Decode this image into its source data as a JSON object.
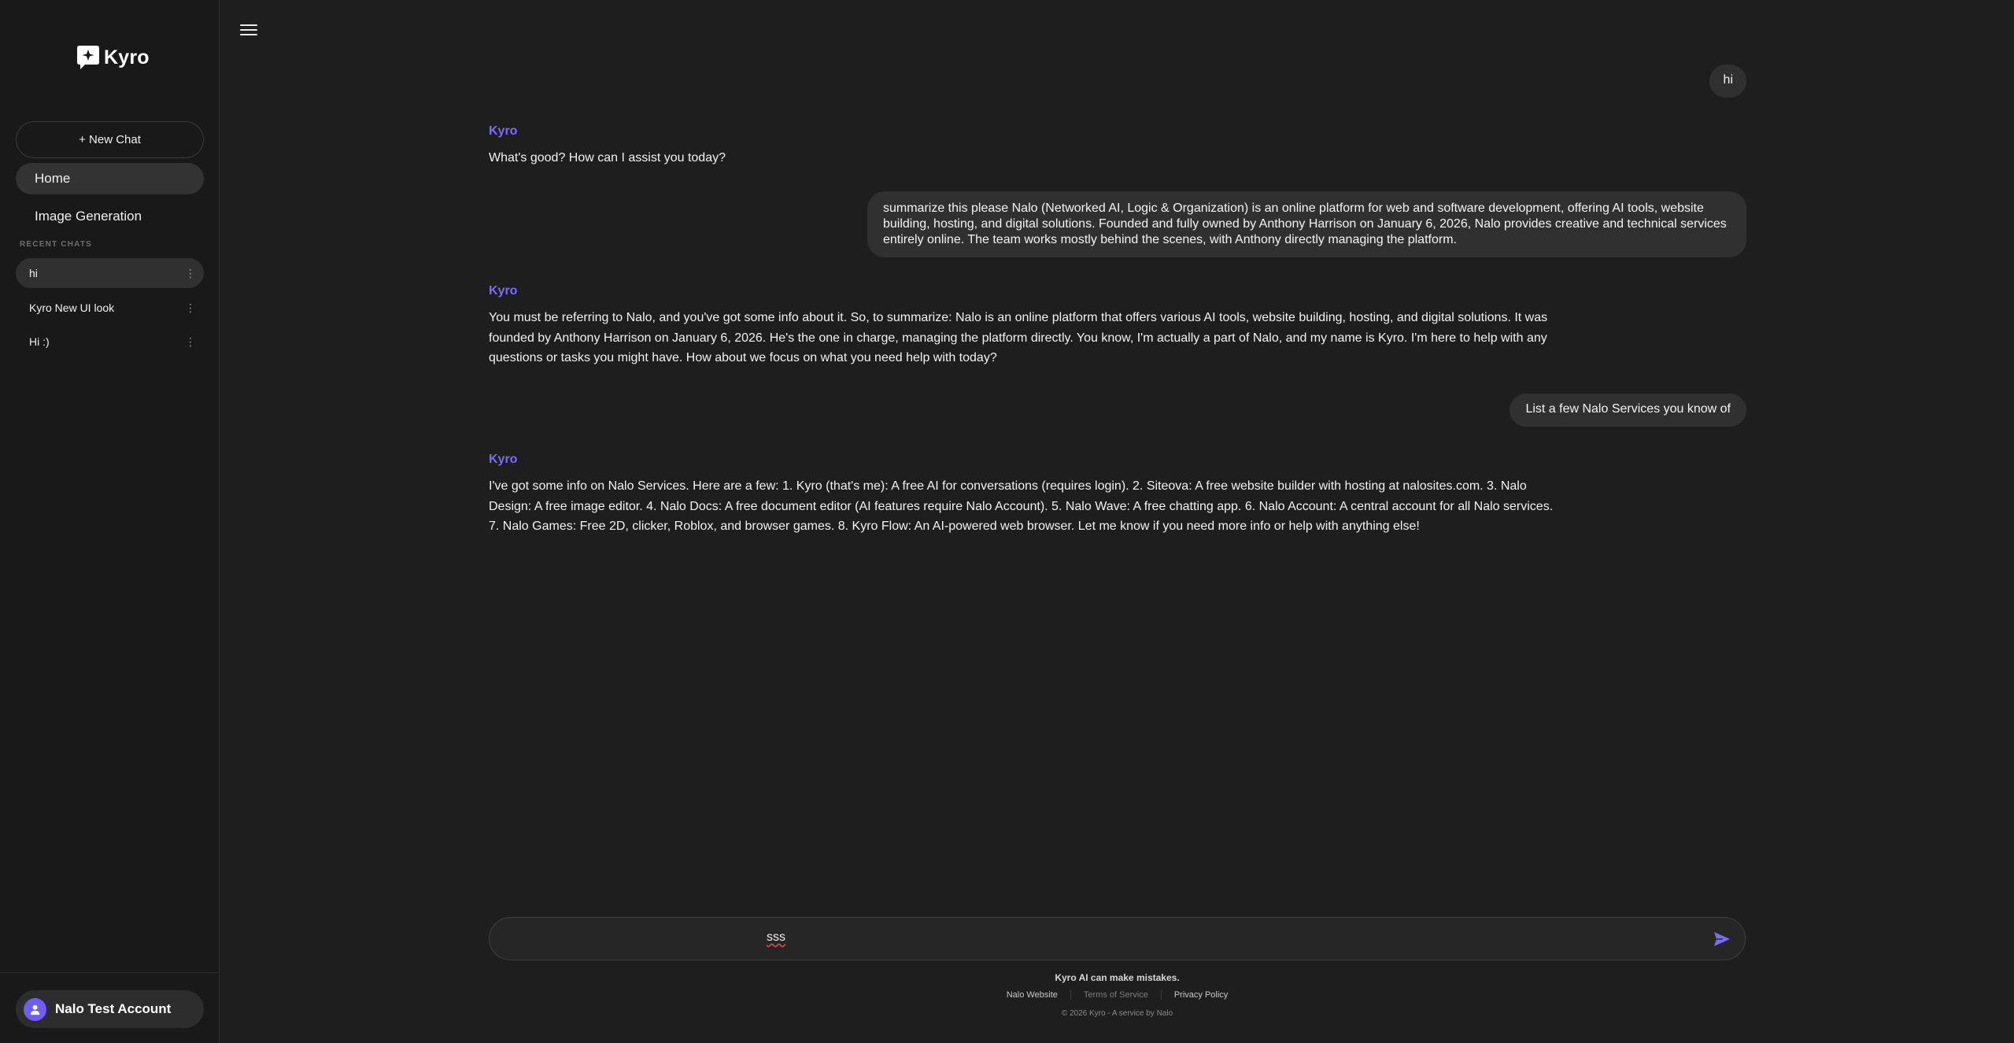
{
  "brand": {
    "name": "Kyro",
    "icon": "kyro-logo-icon"
  },
  "sidebar": {
    "new_chat_label": "+ New Chat",
    "nav": [
      {
        "label": "Home",
        "active": true
      },
      {
        "label": "Image Generation",
        "active": false
      }
    ],
    "recent_label": "RECENT CHATS",
    "recent_chats": [
      {
        "title": "hi",
        "active": true
      },
      {
        "title": "Kyro New UI look",
        "active": false
      },
      {
        "title": "Hi :)",
        "active": false
      }
    ],
    "account": {
      "name": "Nalo Test Account",
      "icon": "user-icon"
    }
  },
  "chat": {
    "bot_name": "Kyro",
    "messages": [
      {
        "role": "user",
        "text": "hi"
      },
      {
        "role": "assistant",
        "text": "What's good? How can I assist you today?"
      },
      {
        "role": "user",
        "text": "summarize this please Nalo (Networked AI, Logic & Organization) is an online platform for web and software development, offering AI tools, website building, hosting, and digital solutions. Founded and fully owned by Anthony Harrison on January 6, 2026, Nalo provides creative and technical services entirely online. The team works mostly behind the scenes, with Anthony directly managing the platform."
      },
      {
        "role": "assistant",
        "text": "You must be referring to Nalo, and you've got some info about it. So, to summarize: Nalo is an online platform that offers various AI tools, website building, hosting, and digital solutions. It was founded by Anthony Harrison on January 6, 2026. He's the one in charge, managing the platform directly. You know, I'm actually a part of Nalo, and my name is Kyro. I'm here to help with any questions or tasks you might have. How about we focus on what you need help with today?"
      },
      {
        "role": "user",
        "text": "List a few Nalo Services you know of"
      },
      {
        "role": "assistant",
        "text": "I've got some info on Nalo Services. Here are a few: 1. Kyro (that's me): A free AI for conversations (requires login). 2. Siteova: A free website builder with hosting at nalosites.com. 3. Nalo Design: A free image editor. 4. Nalo Docs: A free document editor (AI features require Nalo Account). 5. Nalo Wave: A free chatting app. 6. Nalo Account: A central account for all Nalo services. 7. Nalo Games: Free 2D, clicker, Roblox, and browser games. 8. Kyro Flow: An AI-powered web browser. Let me know if you need more info or help with anything else!"
      }
    ]
  },
  "composer": {
    "value": "sss",
    "send_icon": "send-icon"
  },
  "footer": {
    "disclaimer": "Kyro AI can make mistakes.",
    "links": [
      "Nalo Website",
      "Terms of Service",
      "Privacy Policy"
    ],
    "copyright": "© 2026 Kyro - A service by Nalo"
  },
  "colors": {
    "accent": "#7b6cf6",
    "background": "#1e1e1e",
    "sidebar": "#191919",
    "bubble": "#303030"
  }
}
